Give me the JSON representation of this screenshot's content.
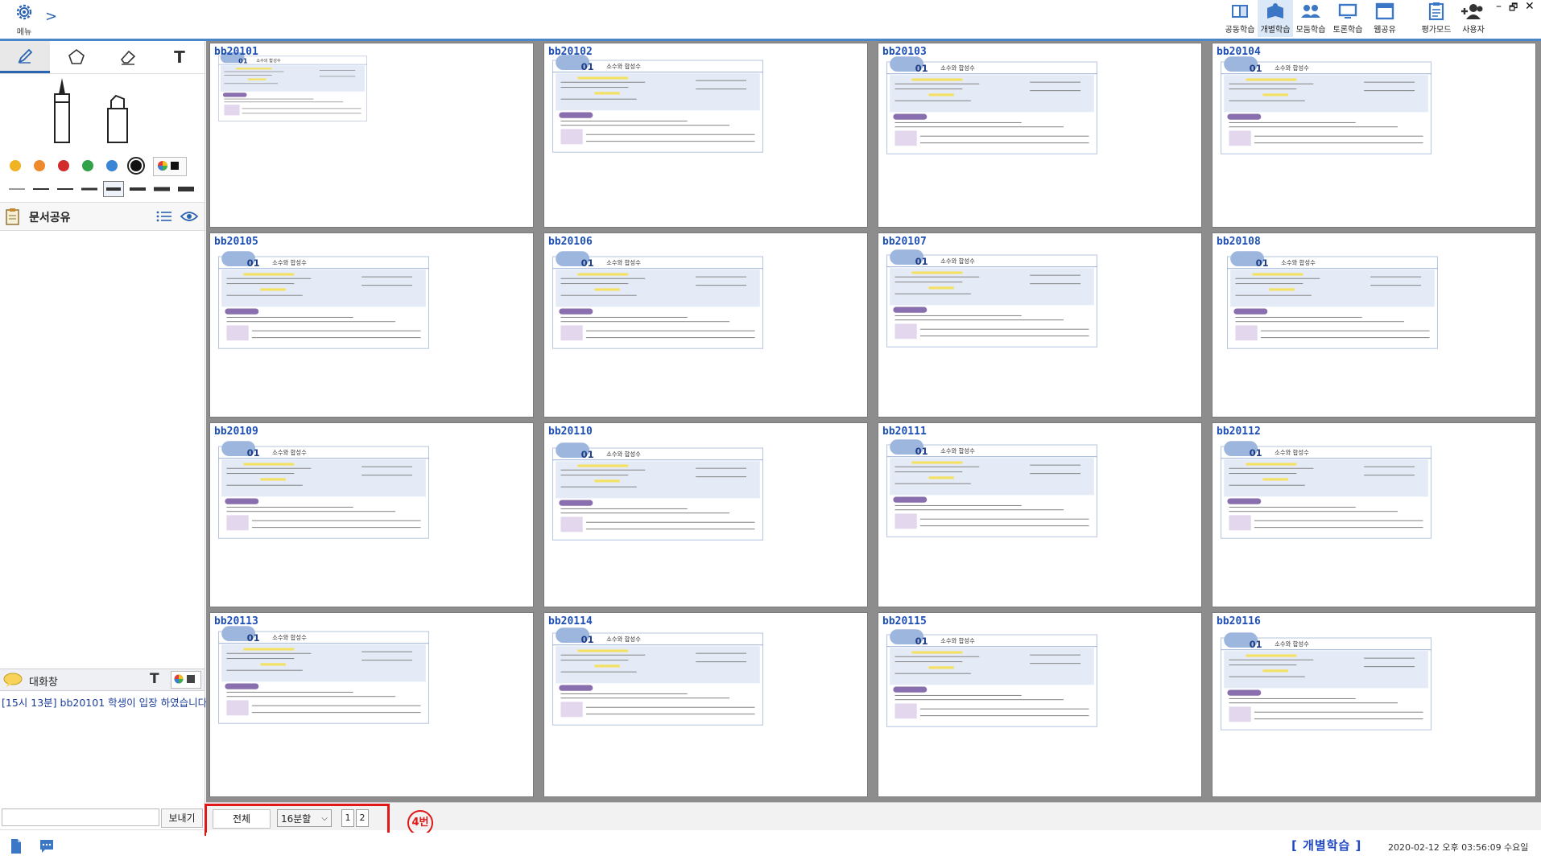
{
  "topbar": {
    "menu_label": "메뉴",
    "expand_symbol": ">",
    "modes": [
      {
        "label": "공동학습",
        "icon": "book-shared-icon"
      },
      {
        "label": "개별학습",
        "icon": "book-individual-icon"
      },
      {
        "label": "모둠학습",
        "icon": "group-icon"
      },
      {
        "label": "토론학습",
        "icon": "monitor-icon"
      },
      {
        "label": "웹공유",
        "icon": "web-window-icon"
      },
      {
        "label": "평가모드",
        "icon": "clipboard-icon"
      },
      {
        "label": "사용자",
        "icon": "add-user-icon"
      }
    ],
    "window_controls": [
      "–",
      "🗗",
      "✕"
    ]
  },
  "left_panel": {
    "tools": [
      "pencil-icon",
      "pentagon-icon",
      "eraser-icon",
      "text-icon"
    ],
    "text_tool_glyph": "T",
    "colors": [
      "#f0b323",
      "#ee8a2b",
      "#d12b2b",
      "#2fa24a",
      "#3a86d6",
      "#111111"
    ],
    "doc_share_title": "문서공유",
    "chat_title": "대화창",
    "chat_text_glyph": "T",
    "chat_message": "[15시 13분] bb20101 학생이 입장 하였습니다.",
    "send_label": "보내기",
    "chat_input_value": ""
  },
  "grid": {
    "students": [
      "bb20101",
      "bb20102",
      "bb20103",
      "bb20104",
      "bb20105",
      "bb20106",
      "bb20107",
      "bb20108",
      "bb20109",
      "bb20110",
      "bb20111",
      "bb20112",
      "bb20113",
      "bb20114",
      "bb20115",
      "bb20116"
    ],
    "thumb_number": "01",
    "thumb_title_first": "소수의 합성수",
    "thumb_title": "소수와 합성수"
  },
  "bottom": {
    "all_label": "전체",
    "split_value": "16분할",
    "pages": [
      "1",
      "2"
    ],
    "annotation": "4번",
    "mode_label": "[ 개별학습 ]",
    "datetime": "2020-02-12 오후 03:56:09 수요일"
  }
}
